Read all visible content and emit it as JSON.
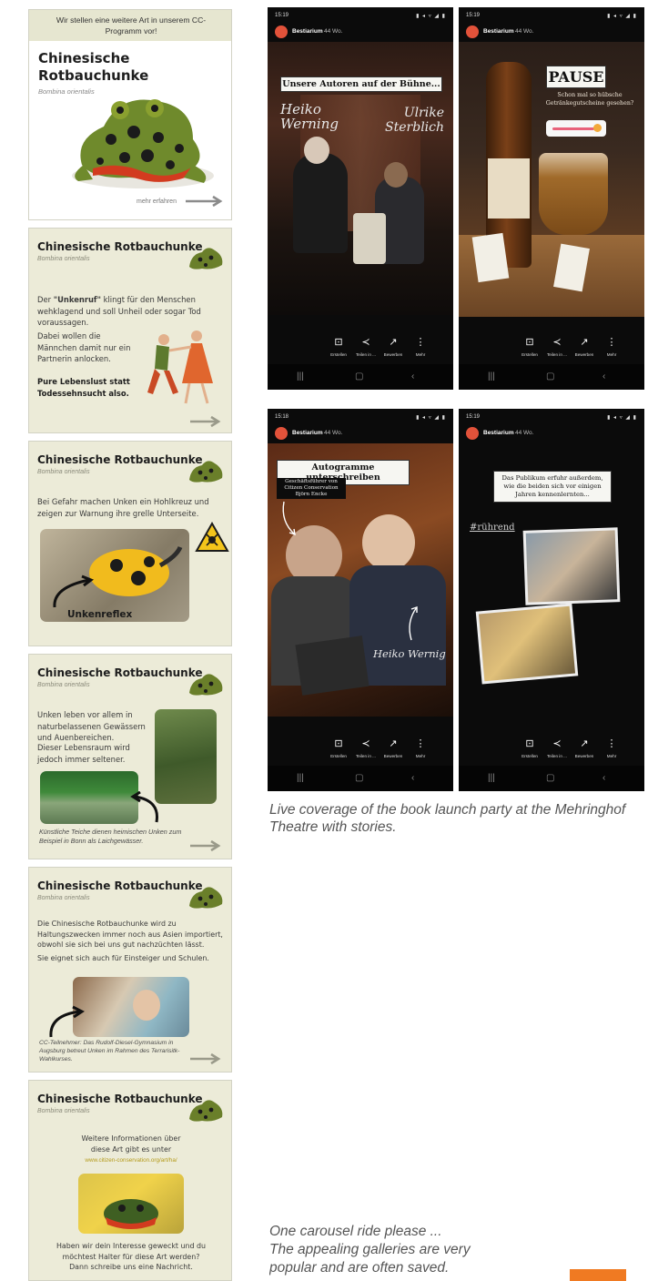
{
  "slides": {
    "intro": {
      "banner": "Wir stellen eine weitere Art in unserem CC-Programm vor!",
      "title": "Chinesische Rotbauchunke",
      "subtitle": "Bombina orientalis",
      "more": "mehr erfahren"
    },
    "s2": {
      "title": "Chinesische Rotbauchunke",
      "subtitle": "Bombina orientalis",
      "p1_pre": "Der ",
      "p1_bold": "\"Unkenruf\"",
      "p1_post": " klingt für den Menschen wehklagend und soll Unheil oder sogar Tod voraussagen.",
      "p2": "Dabei wollen die Männchen damit nur ein Partnerin anlocken.",
      "p3": "Pure Lebenslust statt Todessehnsucht also."
    },
    "s3": {
      "title": "Chinesische Rotbauchunke",
      "subtitle": "Bombina orientalis",
      "body": "Bei Gefahr machen Unken ein Hohlkreuz und zeigen zur Warnung ihre grelle Unterseite.",
      "label": "Unkenreflex"
    },
    "s4": {
      "title": "Chinesische Rotbauchunke",
      "subtitle": "Bombina orientalis",
      "p1": "Unken leben vor allem in naturbelassenen Gewässern und Auenbereichen.",
      "p2": "Dieser Lebensraum wird jedoch immer seltener.",
      "caption": "Künstliche Teiche dienen heimischen Unken zum Beispiel in Bonn als Laichgewässer."
    },
    "s5": {
      "title": "Chinesische Rotbauchunke",
      "subtitle": "Bombina orientalis",
      "p1": "Die Chinesische Rotbauchunke wird zu Haltungszwecken immer noch aus Asien importiert, obwohl sie sich bei uns gut nachzüchten lässt.",
      "p2": "Sie eignet sich auch für Einsteiger und Schulen.",
      "caption": "CC-Teilnehmer: Das Rudolf-Diesel-Gymnasium in Augsburg betreut Unken im Rahmen des Terrarisitk-Wahlkurses."
    },
    "s6": {
      "title": "Chinesische Rotbauchunke",
      "subtitle": "Bombina orientalis",
      "p1": "Weitere Informationen über diese Art gibt es unter",
      "link": "www.citizen-conservation.org/art/ha/",
      "p2": "Haben wir dein Interesse geweckt und du möchtest Halter für diese Art werden? Dann schreibe uns eine Nachricht."
    }
  },
  "stories": {
    "account": "Bestiarium",
    "age": "44 Wo.",
    "actions": [
      "Erstellen",
      "Teilen in ...",
      "Bewerben",
      "Mehr"
    ],
    "s1": {
      "time": "15:19",
      "banner": "Unsere Autoren auf der Bühne...",
      "name_left": "Heiko Werning",
      "name_right": "Ulrike Sterblich"
    },
    "s2": {
      "time": "15:19",
      "title": "PAUSE",
      "text": "Schon mal so hübsche Getränkegutscheine gesehen?"
    },
    "s3": {
      "time": "15:18",
      "banner": "Autogramme unterschreiben",
      "sub": "Geschäftsführer von Citizen Conservation Björn Encke",
      "name": "Heiko Wernig"
    },
    "s4": {
      "time": "15:19",
      "text": "Das Publikum erfuhr außerdem, wie die beiden sich vor einigen Jahren kennenlernten...",
      "tag": "#rührend"
    }
  },
  "captions": {
    "stories": "Live coverage of the book launch party at the Mehringhof Theatre with stories.",
    "carousel_1": "One carousel ride please ...",
    "carousel_2": "The appealing galleries are very",
    "carousel_3": "popular and are often saved."
  },
  "colors": {
    "accent": "#f07a22",
    "slide_bg": "#ecebd8",
    "avatar": "#e2523a"
  }
}
